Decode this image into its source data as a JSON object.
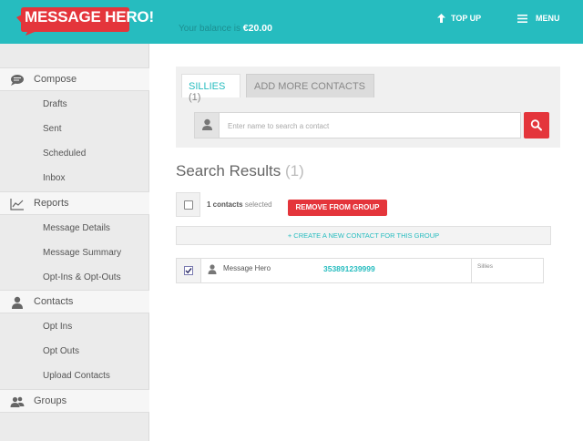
{
  "header": {
    "logo_text": "MESSAGE HERO!",
    "balance_label": "Your balance is",
    "balance_amount": "€20.00",
    "topup_label": "TOP UP",
    "menu_label": "MENU",
    "bg_color": "#26bcbf",
    "logo_color": "#e4353b"
  },
  "sidebar": {
    "sections": [
      {
        "label": "Compose",
        "icon": "speech-bubble-icon",
        "items": [
          "Drafts",
          "Sent",
          "Scheduled",
          "Inbox"
        ]
      },
      {
        "label": "Reports",
        "icon": "line-chart-icon",
        "items": [
          "Message Details",
          "Message Summary",
          "Opt-Ins & Opt-Outs"
        ]
      },
      {
        "label": "Contacts",
        "icon": "person-icon",
        "items": [
          "Opt Ins",
          "Opt Outs",
          "Upload Contacts"
        ]
      },
      {
        "label": "Groups",
        "icon": "people-icon",
        "items": []
      }
    ]
  },
  "tabs": {
    "group_name": "SILLIES",
    "group_count": "(1)",
    "add_more": "ADD MORE CONTACTS"
  },
  "search": {
    "placeholder": "Enter name to search a contact",
    "value": ""
  },
  "results": {
    "title": "Search Results",
    "count": "(1)",
    "selected_count": "1 contacts",
    "selected_suffix": "selected",
    "remove_button": "REMOVE FROM GROUP",
    "create_contact": "+   CREATE A NEW CONTACT FOR THIS GROUP",
    "rows": [
      {
        "name": "Message Hero",
        "phone": "353891239999",
        "group": "Sillies",
        "checked": true
      }
    ]
  },
  "colors": {
    "accent": "#26bcbf",
    "danger": "#e4353b"
  }
}
